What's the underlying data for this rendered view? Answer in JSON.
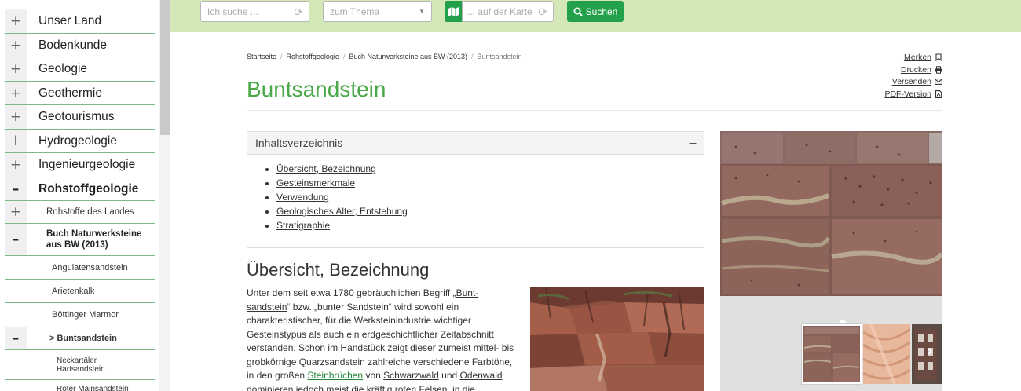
{
  "sidebar": {
    "items": [
      {
        "toggle": "+",
        "label": "Unser Land"
      },
      {
        "toggle": "+",
        "label": "Bodenkunde"
      },
      {
        "toggle": "+",
        "label": "Geologie"
      },
      {
        "toggle": "+",
        "label": "Geothermie"
      },
      {
        "toggle": "+",
        "label": "Geotourismus"
      },
      {
        "toggle": "I",
        "label": "Hydrogeologie"
      },
      {
        "toggle": "+",
        "label": "Ingenieurgeologie"
      },
      {
        "toggle": "–",
        "label": "Rohstoffgeologie"
      }
    ],
    "sub_items": [
      {
        "toggle": "+",
        "label": "Rohstoffe des Landes"
      },
      {
        "toggle": "–",
        "label": "Buch Naturwerksteine aus BW (2013)"
      }
    ],
    "sub_sub_items": [
      {
        "label": "Angulatensandstein"
      },
      {
        "label": "Arietenkalk"
      },
      {
        "label": "Böttinger Marmor"
      }
    ],
    "current_item": {
      "toggle": "–",
      "prefix": ">",
      "label": "Buntsandstein"
    },
    "leaf_items": [
      {
        "label": "Neckartäler Hartsandstein"
      },
      {
        "label": "Roter Mainsandstein"
      }
    ]
  },
  "search": {
    "query_placeholder": "Ich suche ...",
    "topic_placeholder": "zum Thema",
    "map_placeholder": "... auf der Karte",
    "button_label": "Suchen"
  },
  "breadcrumb": [
    "Startseite",
    "Rohstoffgeologie",
    "Buch Naturwerksteine aus BW (2013)",
    "Buntsandstein"
  ],
  "actions": [
    "Merken",
    "Drucken",
    "Versenden",
    "PDF-Version"
  ],
  "page_title": "Buntsandstein",
  "toc": {
    "title": "Inhaltsverzeichnis",
    "toggle": "–",
    "items": [
      "Übersicht, Bezeichnung",
      "Gesteinsmerkmale",
      "Verwendung",
      "Geologisches Alter, Entstehung",
      "Stratigraphie"
    ]
  },
  "section": {
    "title": "Übersicht, Bezeichnung",
    "t1": "Unter dem seit etwa 1780 gebräuchlichen Begriff „",
    "l1": "Bunt-sandstein",
    "t2": "“ bzw. „bunter Sandstein“ wird sowohl ein charakteristischer, für die Werksteinindustrie wichtiger Gesteinstypus als auch ein erdgeschichtlicher Zeitabschnitt verstanden. Schon im Handstück zeigt dieser zumeist mittel- bis grobkörnige Quarzsandstein zahlreiche verschiedene Farbtöne, in den großen ",
    "l2": "Steinbrüchen",
    "t3": " von ",
    "l3": "Schwarzwald",
    "t4": " und ",
    "l4": "Odenwald",
    "t5": " dominieren jedoch meist die kräftig roten Felsen, in die"
  },
  "colors": {
    "brand_green": "#22a04a",
    "title_green": "#4aaa4a",
    "topbar_bg": "#d4e8b7",
    "nav_rule": "#7fb77e"
  }
}
